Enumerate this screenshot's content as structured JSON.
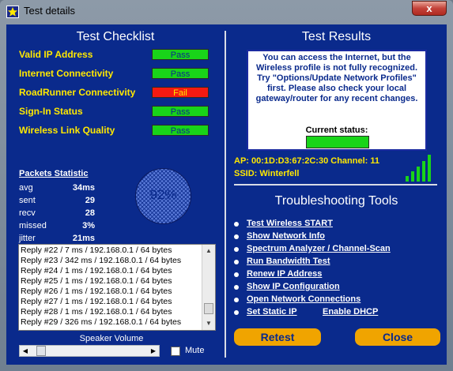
{
  "window": {
    "title": "Test details",
    "close_glyph": "x"
  },
  "checklist": {
    "title": "Test Checklist",
    "items": [
      {
        "label": "Valid IP Address",
        "status": "Pass"
      },
      {
        "label": "Internet Connectivity",
        "status": "Pass"
      },
      {
        "label": "RoadRunner Connectivity",
        "status": "Fail"
      },
      {
        "label": "Sign-In Status",
        "status": "Pass"
      },
      {
        "label": "Wireless Link Quality",
        "status": "Pass"
      }
    ]
  },
  "packets": {
    "title": "Packets Statistic",
    "stats": [
      {
        "label": "avg",
        "value": "34ms"
      },
      {
        "label": "sent",
        "value": "29"
      },
      {
        "label": "recv",
        "value": "28"
      },
      {
        "label": "missed",
        "value": "3%"
      },
      {
        "label": "jitter",
        "value": "21ms"
      }
    ],
    "gauge": "92%",
    "replies": [
      "Reply #22 / 7 ms / 192.168.0.1 / 64 bytes",
      "Reply #23 / 342 ms / 192.168.0.1 / 64 bytes",
      "Reply #24 / 1 ms / 192.168.0.1 / 64 bytes",
      "Reply #25 / 1 ms / 192.168.0.1 / 64 bytes",
      "Reply #26 / 1 ms / 192.168.0.1 / 64 bytes",
      "Reply #27 / 1 ms / 192.168.0.1 / 64 bytes",
      "Reply #28 / 1 ms / 192.168.0.1 / 64 bytes",
      "Reply #29 / 326 ms / 192.168.0.1 / 64 bytes"
    ]
  },
  "speaker": {
    "label": "Speaker Volume",
    "mute_label": "Mute",
    "level": 0.05
  },
  "results": {
    "title": "Test Results",
    "message": "You can access the Internet, but the Wireless profile is not fully recognized. Try \"Options/Update Network Profiles\" first. Please also check your local gateway/router for any recent changes.",
    "current_status_label": "Current status:",
    "ap_line": "AP: 00:1D:D3:67:2C:30  Channel: 11",
    "ssid_line": "SSID: Winterfell",
    "signal_bars": 5
  },
  "tools": {
    "title": "Troubleshooting Tools",
    "links": [
      "Test Wireless START",
      "Show Network Info",
      "Spectrum Analyzer / Channel-Scan",
      "Run Bandwidth Test",
      "Renew IP Address",
      "Show IP Configuration",
      "Open Network Connections"
    ],
    "set_static_ip": "Set Static IP",
    "enable_dhcp": "Enable DHCP"
  },
  "buttons": {
    "retest": "Retest",
    "close": "Close"
  },
  "colors": {
    "panel": "#0a2a8c",
    "pass": "#19d419",
    "fail": "#f41a12",
    "accent": "#ffe800",
    "button": "#f0a400"
  },
  "icons": {
    "app": "star-icon",
    "signal": "signal-strength-icon"
  }
}
